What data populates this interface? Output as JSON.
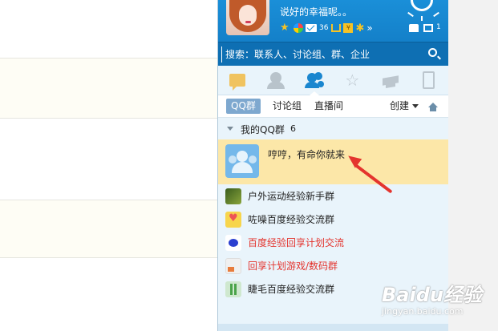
{
  "profile": {
    "signature": "说好的幸福呢。。",
    "mail_count": "36",
    "message_count": "1",
    "status_icons": [
      "star-icon",
      "color-circle-icon",
      "mail-icon",
      "cart-icon",
      "box-icon",
      "person-icon",
      "more-icon"
    ]
  },
  "search": {
    "placeholder": "搜索：联系人、讨论组、群、企业"
  },
  "tabs": [
    "chat-icon",
    "contact-icon",
    "group-icon",
    "favorite-icon",
    "cap-icon",
    "phone-icon"
  ],
  "subtabs": {
    "qq_group": "QQ群",
    "discussion": "讨论组",
    "live": "直播间",
    "create": "创建"
  },
  "group_section": {
    "label": "我的QQ群",
    "count": "6"
  },
  "featured_group": {
    "name": "哼哼，有命你就来"
  },
  "groups": [
    {
      "name": "户外运动经验新手群",
      "color": "#222222"
    },
    {
      "name": "咗噪百度经验交流群",
      "color": "#222222"
    },
    {
      "name": "百度经验回享计划交流",
      "color": "#e4342e"
    },
    {
      "name": "回享计划游戏/数码群",
      "color": "#e4342e"
    },
    {
      "name": "睫毛百度经验交流群",
      "color": "#222222"
    }
  ],
  "watermark": {
    "brand": "Baidu经验",
    "url": "jingyan.baidu.com"
  },
  "colors": {
    "header": "#1a8fd8",
    "highlight": "#fce7a8",
    "arrow": "#e4342e"
  }
}
